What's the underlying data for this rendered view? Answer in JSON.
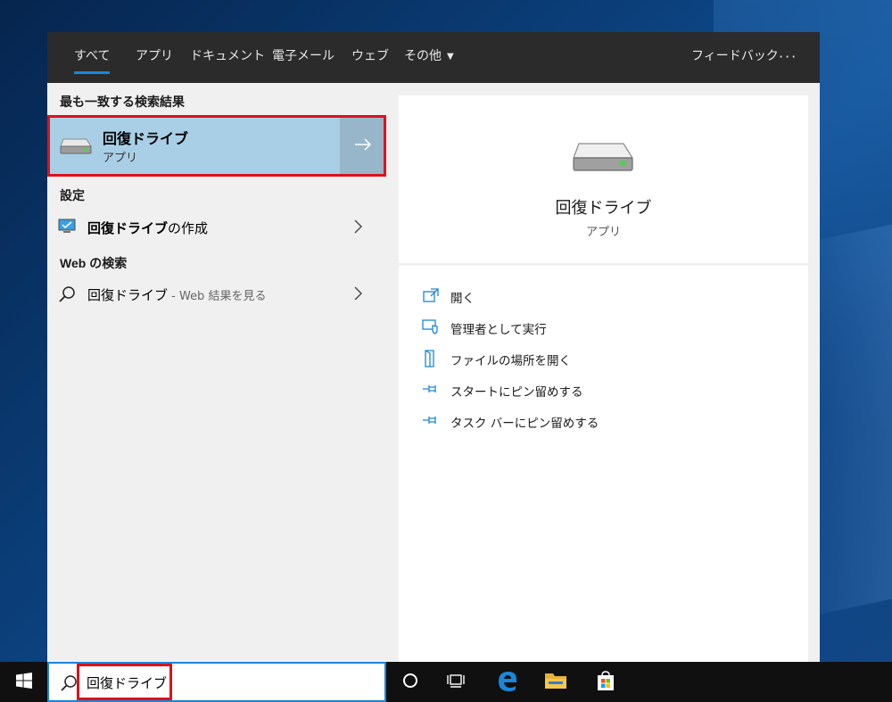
{
  "tabs": [
    {
      "label": "すべて",
      "active": true
    },
    {
      "label": "アプリ"
    },
    {
      "label": "ドキュメント"
    },
    {
      "label": "電子メール"
    },
    {
      "label": "ウェブ"
    },
    {
      "label": "その他"
    }
  ],
  "feedback_label": "フィードバック",
  "more_label": "···",
  "best_match": {
    "section_title": "最も一致する検索結果",
    "title": "回復ドライブ",
    "subtitle": "アプリ"
  },
  "settings": {
    "section_title": "設定",
    "item_bold": "回復ドライブ",
    "item_rest": "の作成"
  },
  "web": {
    "section_title": "Web の検索",
    "item_text": "回復ドライブ",
    "item_sub": " - Web 結果を見る"
  },
  "preview": {
    "title": "回復ドライブ",
    "subtitle": "アプリ",
    "actions": [
      {
        "label": "開く",
        "icon": "open-icon"
      },
      {
        "label": "管理者として実行",
        "icon": "shield-icon"
      },
      {
        "label": "ファイルの場所を開く",
        "icon": "file-location-icon"
      },
      {
        "label": "スタートにピン留めする",
        "icon": "pin-icon"
      },
      {
        "label": "タスク バーにピン留めする",
        "icon": "pin-icon"
      }
    ]
  },
  "search": {
    "value": "回復ドライブ"
  },
  "colors": {
    "accent": "#1a86d9",
    "highlight": "#a9cfe6",
    "annotation_red": "#e0101a"
  }
}
